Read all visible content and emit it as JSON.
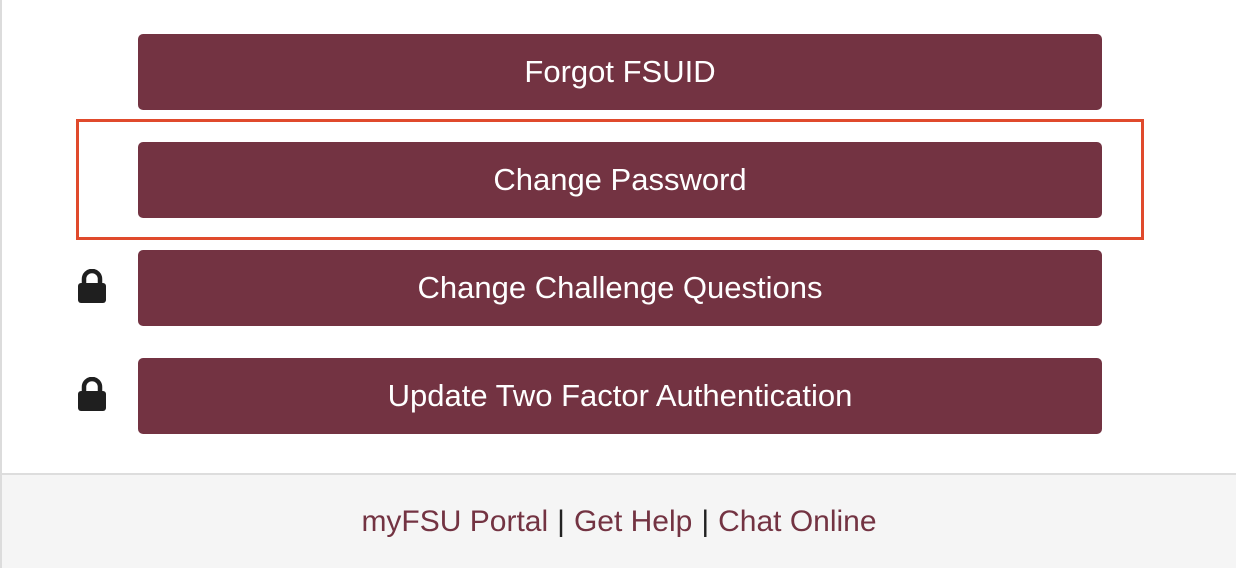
{
  "buttons": {
    "forgot_fsuid": "Forgot FSUID",
    "change_password": "Change Password",
    "change_challenge_questions": "Change Challenge Questions",
    "update_two_factor": "Update Two Factor Authentication"
  },
  "icons": {
    "lock": "lock-icon"
  },
  "footer": {
    "link_portal": "myFSU Portal",
    "separator": "|",
    "link_help": "Get Help",
    "link_chat": "Chat Online"
  },
  "colors": {
    "button_bg": "#733342",
    "button_text": "#ffffff",
    "highlight": "#e04a2c",
    "footer_bg": "#f5f5f5",
    "link": "#733342"
  }
}
